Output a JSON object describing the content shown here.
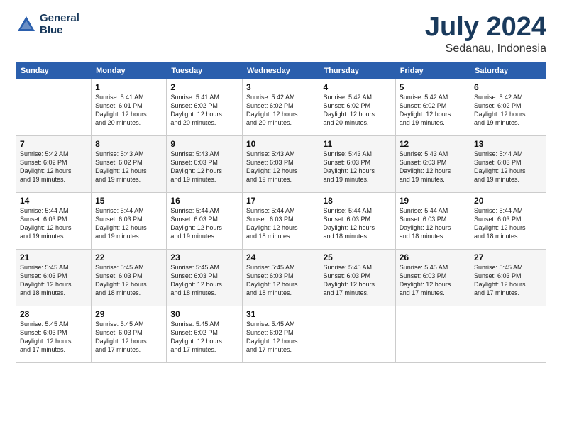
{
  "logo": {
    "line1": "General",
    "line2": "Blue"
  },
  "title": {
    "month": "July 2024",
    "location": "Sedanau, Indonesia"
  },
  "headers": [
    "Sunday",
    "Monday",
    "Tuesday",
    "Wednesday",
    "Thursday",
    "Friday",
    "Saturday"
  ],
  "weeks": [
    [
      {
        "day": "",
        "info": ""
      },
      {
        "day": "1",
        "info": "Sunrise: 5:41 AM\nSunset: 6:01 PM\nDaylight: 12 hours\nand 20 minutes."
      },
      {
        "day": "2",
        "info": "Sunrise: 5:41 AM\nSunset: 6:02 PM\nDaylight: 12 hours\nand 20 minutes."
      },
      {
        "day": "3",
        "info": "Sunrise: 5:42 AM\nSunset: 6:02 PM\nDaylight: 12 hours\nand 20 minutes."
      },
      {
        "day": "4",
        "info": "Sunrise: 5:42 AM\nSunset: 6:02 PM\nDaylight: 12 hours\nand 20 minutes."
      },
      {
        "day": "5",
        "info": "Sunrise: 5:42 AM\nSunset: 6:02 PM\nDaylight: 12 hours\nand 19 minutes."
      },
      {
        "day": "6",
        "info": "Sunrise: 5:42 AM\nSunset: 6:02 PM\nDaylight: 12 hours\nand 19 minutes."
      }
    ],
    [
      {
        "day": "7",
        "info": "Sunrise: 5:42 AM\nSunset: 6:02 PM\nDaylight: 12 hours\nand 19 minutes."
      },
      {
        "day": "8",
        "info": "Sunrise: 5:43 AM\nSunset: 6:02 PM\nDaylight: 12 hours\nand 19 minutes."
      },
      {
        "day": "9",
        "info": "Sunrise: 5:43 AM\nSunset: 6:03 PM\nDaylight: 12 hours\nand 19 minutes."
      },
      {
        "day": "10",
        "info": "Sunrise: 5:43 AM\nSunset: 6:03 PM\nDaylight: 12 hours\nand 19 minutes."
      },
      {
        "day": "11",
        "info": "Sunrise: 5:43 AM\nSunset: 6:03 PM\nDaylight: 12 hours\nand 19 minutes."
      },
      {
        "day": "12",
        "info": "Sunrise: 5:43 AM\nSunset: 6:03 PM\nDaylight: 12 hours\nand 19 minutes."
      },
      {
        "day": "13",
        "info": "Sunrise: 5:44 AM\nSunset: 6:03 PM\nDaylight: 12 hours\nand 19 minutes."
      }
    ],
    [
      {
        "day": "14",
        "info": "Sunrise: 5:44 AM\nSunset: 6:03 PM\nDaylight: 12 hours\nand 19 minutes."
      },
      {
        "day": "15",
        "info": "Sunrise: 5:44 AM\nSunset: 6:03 PM\nDaylight: 12 hours\nand 19 minutes."
      },
      {
        "day": "16",
        "info": "Sunrise: 5:44 AM\nSunset: 6:03 PM\nDaylight: 12 hours\nand 19 minutes."
      },
      {
        "day": "17",
        "info": "Sunrise: 5:44 AM\nSunset: 6:03 PM\nDaylight: 12 hours\nand 18 minutes."
      },
      {
        "day": "18",
        "info": "Sunrise: 5:44 AM\nSunset: 6:03 PM\nDaylight: 12 hours\nand 18 minutes."
      },
      {
        "day": "19",
        "info": "Sunrise: 5:44 AM\nSunset: 6:03 PM\nDaylight: 12 hours\nand 18 minutes."
      },
      {
        "day": "20",
        "info": "Sunrise: 5:44 AM\nSunset: 6:03 PM\nDaylight: 12 hours\nand 18 minutes."
      }
    ],
    [
      {
        "day": "21",
        "info": "Sunrise: 5:45 AM\nSunset: 6:03 PM\nDaylight: 12 hours\nand 18 minutes."
      },
      {
        "day": "22",
        "info": "Sunrise: 5:45 AM\nSunset: 6:03 PM\nDaylight: 12 hours\nand 18 minutes."
      },
      {
        "day": "23",
        "info": "Sunrise: 5:45 AM\nSunset: 6:03 PM\nDaylight: 12 hours\nand 18 minutes."
      },
      {
        "day": "24",
        "info": "Sunrise: 5:45 AM\nSunset: 6:03 PM\nDaylight: 12 hours\nand 18 minutes."
      },
      {
        "day": "25",
        "info": "Sunrise: 5:45 AM\nSunset: 6:03 PM\nDaylight: 12 hours\nand 17 minutes."
      },
      {
        "day": "26",
        "info": "Sunrise: 5:45 AM\nSunset: 6:03 PM\nDaylight: 12 hours\nand 17 minutes."
      },
      {
        "day": "27",
        "info": "Sunrise: 5:45 AM\nSunset: 6:03 PM\nDaylight: 12 hours\nand 17 minutes."
      }
    ],
    [
      {
        "day": "28",
        "info": "Sunrise: 5:45 AM\nSunset: 6:03 PM\nDaylight: 12 hours\nand 17 minutes."
      },
      {
        "day": "29",
        "info": "Sunrise: 5:45 AM\nSunset: 6:03 PM\nDaylight: 12 hours\nand 17 minutes."
      },
      {
        "day": "30",
        "info": "Sunrise: 5:45 AM\nSunset: 6:02 PM\nDaylight: 12 hours\nand 17 minutes."
      },
      {
        "day": "31",
        "info": "Sunrise: 5:45 AM\nSunset: 6:02 PM\nDaylight: 12 hours\nand 17 minutes."
      },
      {
        "day": "",
        "info": ""
      },
      {
        "day": "",
        "info": ""
      },
      {
        "day": "",
        "info": ""
      }
    ]
  ]
}
